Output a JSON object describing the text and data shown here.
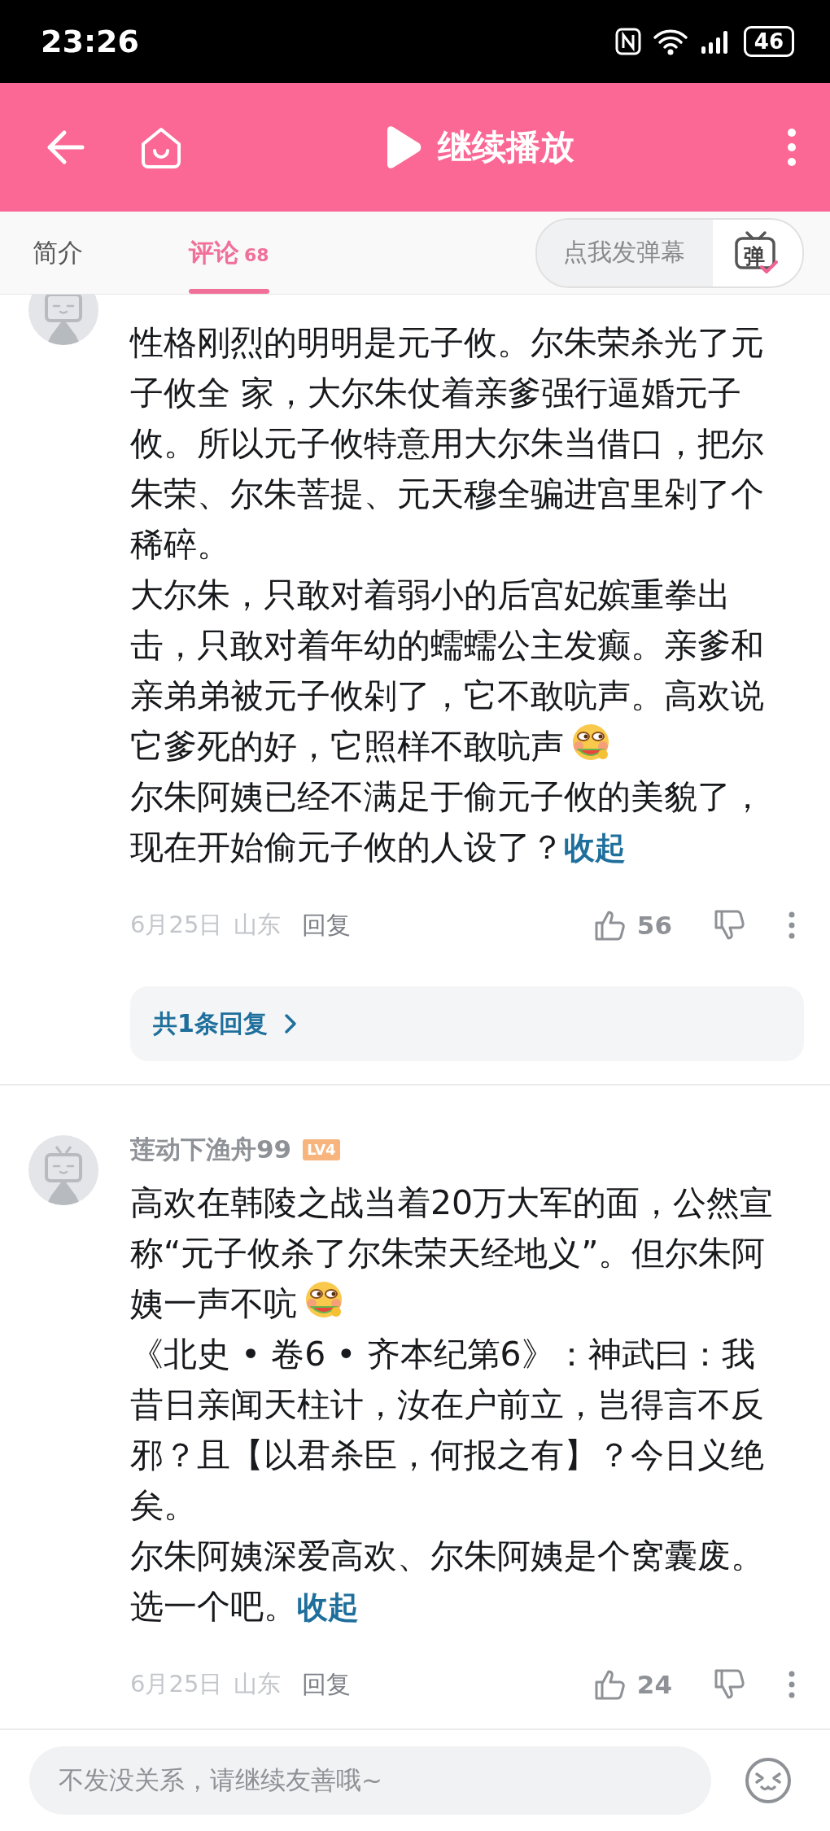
{
  "status_bar": {
    "time": "23:26",
    "battery": "46"
  },
  "header": {
    "title": "继续播放"
  },
  "tabs": [
    {
      "label": "简介",
      "selected": false
    },
    {
      "label": "评论",
      "count": "68",
      "selected": true
    }
  ],
  "danmaku": {
    "label": "点我发弹幕",
    "icon_label": "弹"
  },
  "comments": [
    {
      "paragraphs": [
        {
          "text": "性格刚烈的明明是元子攸。尔朱荣杀光了元子攸全 家，大尔朱仗着亲爹强行逼婚元子攸。所以元子攸特意用大尔朱当借口，把尔朱荣、尔朱菩提、元天穆全骗进宫里剁了个稀碎。",
          "emoji": false
        },
        {
          "text": "大尔朱，只敢对着弱小的后宫妃嫔重拳出击，只敢对着年幼的蠕蠕公主发癫。亲爹和亲弟弟被元子攸剁了，它不敢吭声。高欢说它爹死的好，它照样不敢吭声",
          "emoji": true
        },
        {
          "text": "尔朱阿姨已经不满足于偷元子攸的美貌了，现在开始偷元子攸的人设了？",
          "emoji": false
        }
      ],
      "collapse": "收起",
      "date": "6月25日",
      "location": "山东",
      "reply": "回复",
      "likes": "56",
      "replies": "共1条回复"
    },
    {
      "user": "莲动下渔舟99",
      "level": "LV4",
      "paragraphs": [
        {
          "text": "高欢在韩陵之战当着20万大军的面，公然宣称“元子攸杀了尔朱荣天经地义”。但尔朱阿姨一声不吭",
          "emoji": true
        },
        {
          "text": "《北史 • 卷6 • 齐本纪第6》：神武曰：我昔日亲闻天柱计，汝在户前立，岂得言不反邪？且【以君杀臣，何报之有】？今日义绝矣。",
          "emoji": false
        },
        {
          "text": "尔朱阿姨深爱高欢、尔朱阿姨是个窝囊废。选一个吧。",
          "emoji": false
        }
      ],
      "collapse": "收起",
      "date": "6月25日",
      "location": "山东",
      "reply": "回复",
      "likes": "24"
    }
  ],
  "input": {
    "placeholder": "不发没关系，请继续友善哦~"
  }
}
